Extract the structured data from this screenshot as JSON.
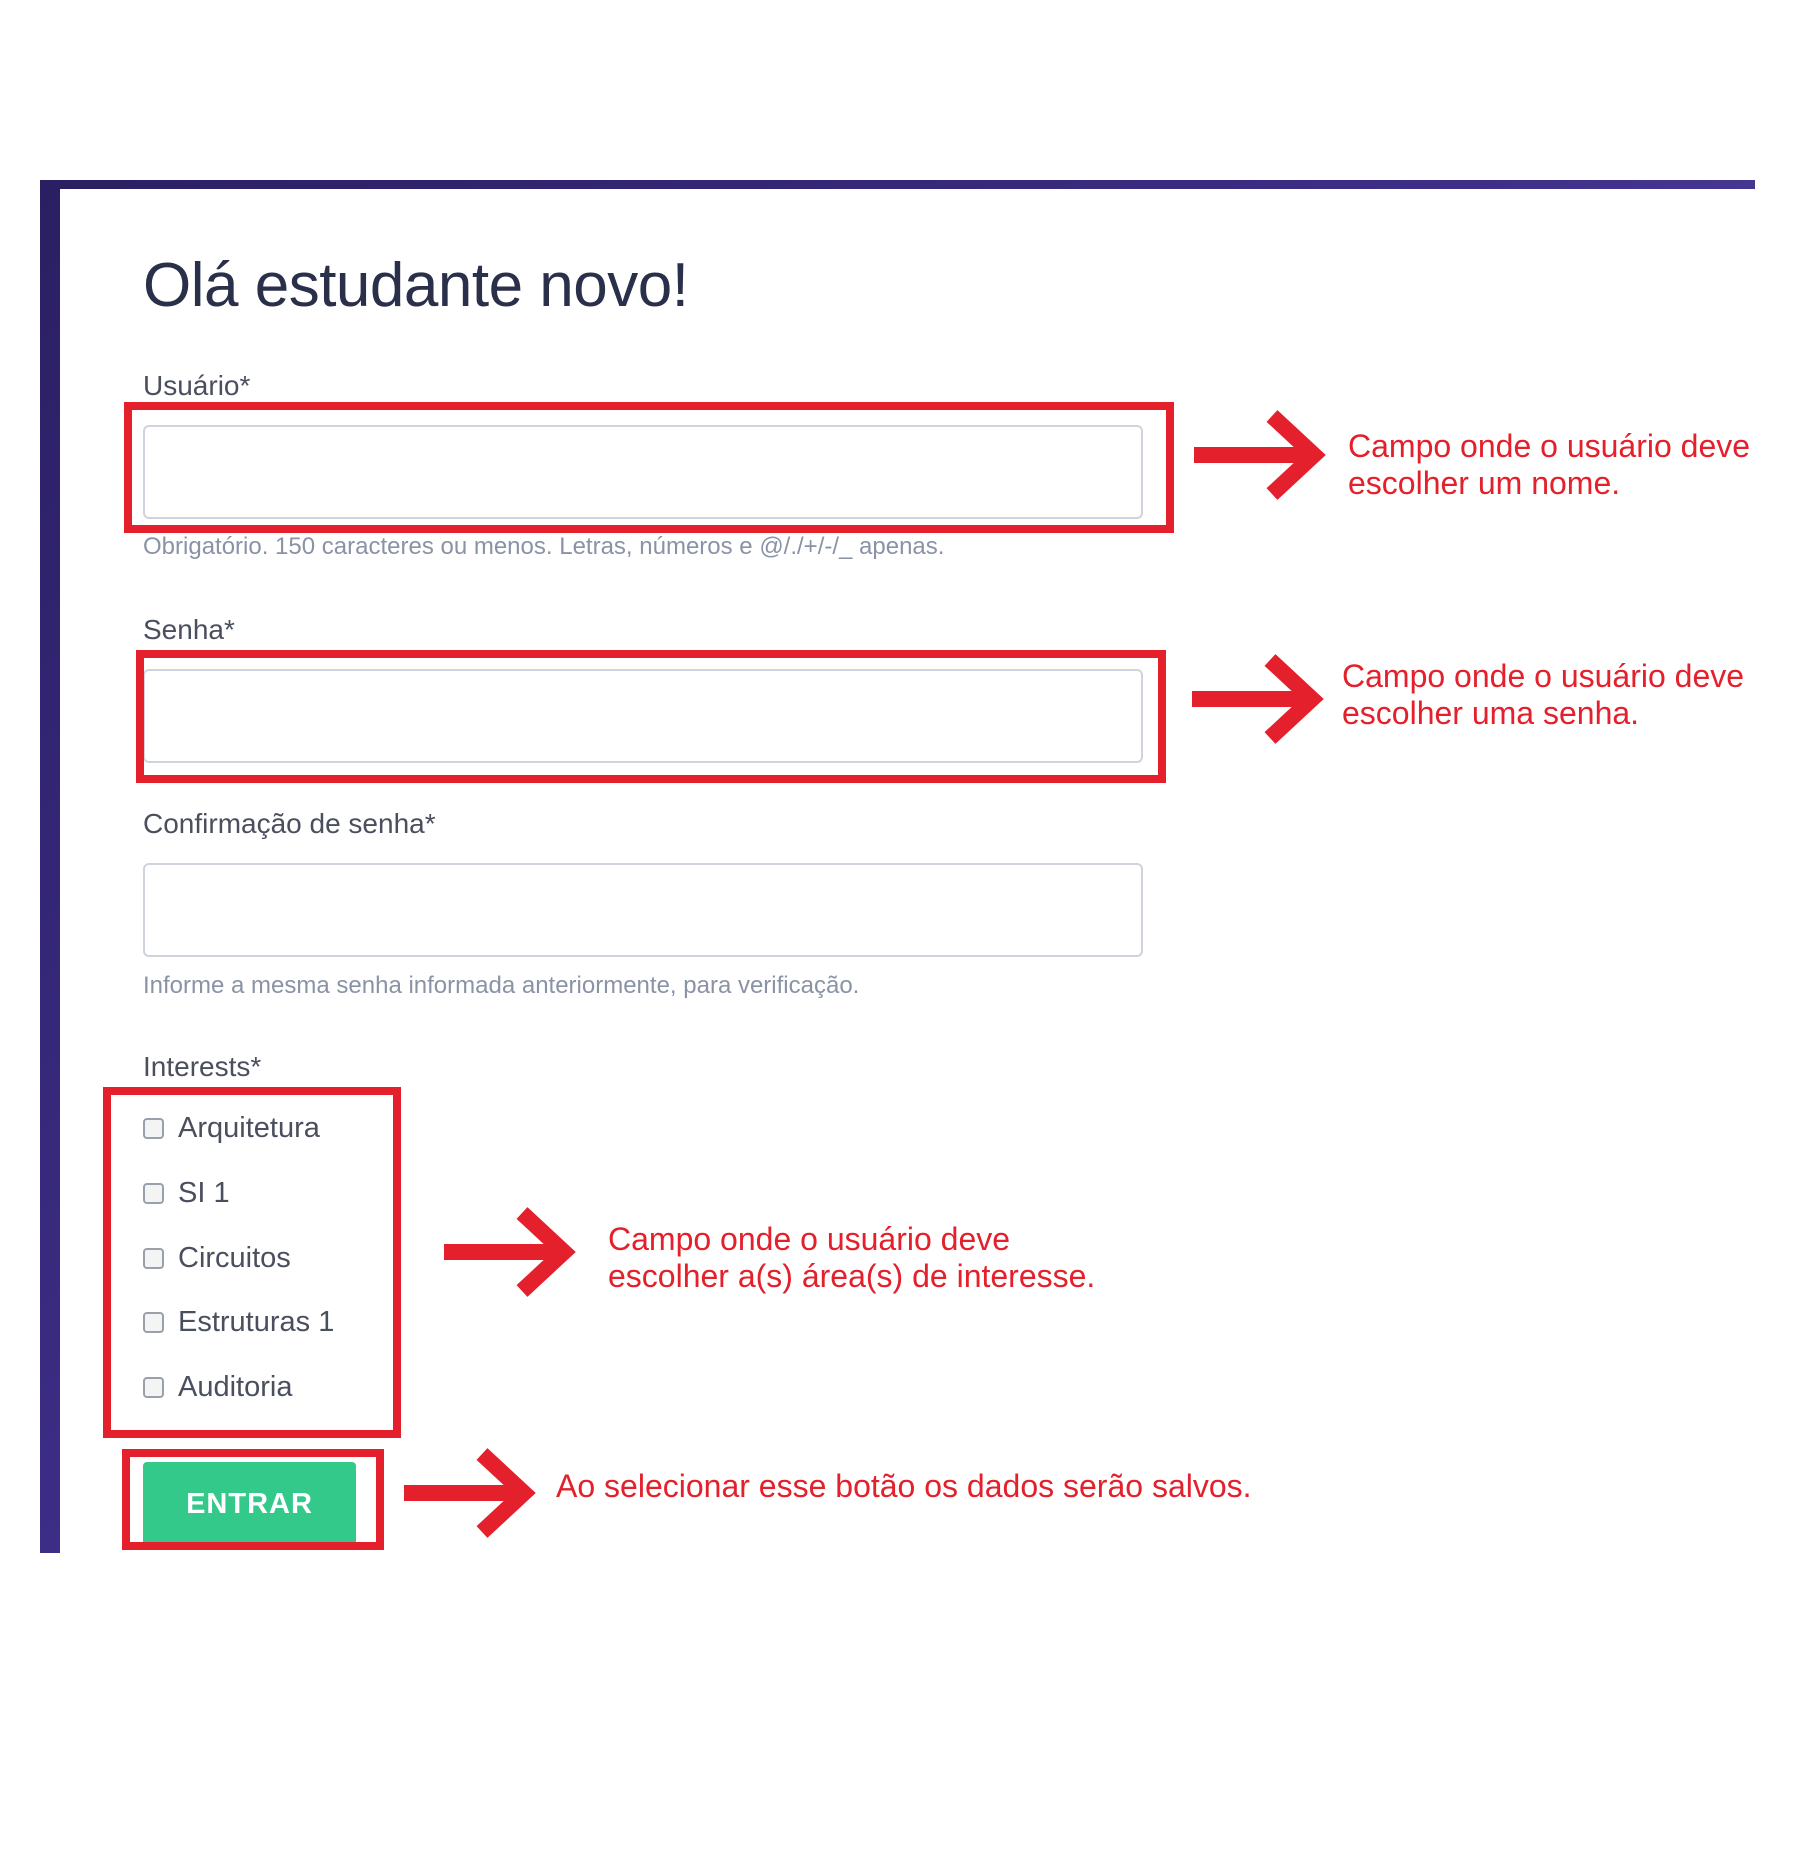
{
  "form": {
    "title": "Olá estudante novo!",
    "username": {
      "label": "Usuário*",
      "value": "",
      "help": "Obrigatório. 150 caracteres ou menos. Letras, números e @/./+/-/_ apenas."
    },
    "password": {
      "label": "Senha*",
      "value": ""
    },
    "password_confirm": {
      "label": "Confirmação de senha*",
      "value": "",
      "help": "Informe a mesma senha informada anteriormente, para verificação."
    },
    "interests": {
      "label": "Interests*",
      "options": [
        {
          "label": "Arquitetura",
          "checked": false
        },
        {
          "label": "SI 1",
          "checked": false
        },
        {
          "label": "Circuitos",
          "checked": false
        },
        {
          "label": "Estruturas 1",
          "checked": false
        },
        {
          "label": "Auditoria",
          "checked": false
        }
      ]
    },
    "submit_label": "ENTRAR"
  },
  "annotations": {
    "username_note": [
      "Campo onde o usuário deve",
      "escolher um nome."
    ],
    "password_note": [
      "Campo onde o usuário deve",
      "escolher uma senha."
    ],
    "interests_note": [
      "Campo onde o usuário deve",
      "escolher a(s) área(s) de interesse."
    ],
    "submit_note": "Ao selecionar esse botão os dados serão salvos."
  },
  "colors": {
    "annotation": "#e3202b",
    "submit_button": "#33c98a",
    "title_text": "#2a2f4a",
    "background_band": "#3d2d86"
  }
}
